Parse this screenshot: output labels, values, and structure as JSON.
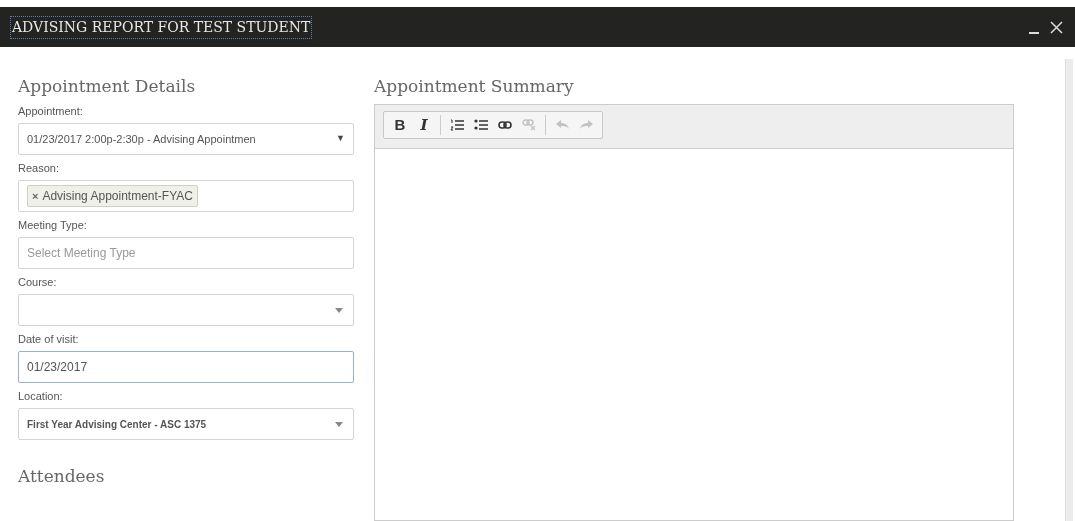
{
  "window": {
    "title": "ADVISING REPORT FOR TEST STUDENT"
  },
  "details": {
    "heading": "Appointment Details",
    "fields": [
      {
        "kind": "select",
        "label": "Appointment:",
        "value": "01/23/2017 2:00p-2:30p - Advising Appointmen",
        "caret": "▼"
      },
      {
        "kind": "tags",
        "label": "Reason:",
        "tags": [
          {
            "remove": "×",
            "text": "Advising Appointment-FYAC"
          }
        ]
      },
      {
        "kind": "text",
        "label": "Meeting Type:",
        "placeholder": "Select Meeting Type"
      },
      {
        "kind": "select",
        "label": "Course:"
      },
      {
        "kind": "text",
        "label": "Date of visit:",
        "value": "01/23/2017",
        "focused": true
      },
      {
        "kind": "select",
        "label": "Location:",
        "value": "First Year Advising Center - ASC 1375",
        "bold": true
      }
    ]
  },
  "attendees": {
    "heading": "Attendees"
  },
  "summary": {
    "heading": "Appointment Summary",
    "toolbar": [
      {
        "kind": "bold",
        "label": "B",
        "disabled": false
      },
      {
        "kind": "italic",
        "label": "I",
        "disabled": false
      },
      {
        "kind": "separator"
      },
      {
        "kind": "ordered-list",
        "disabled": false
      },
      {
        "kind": "bullet-list",
        "disabled": false
      },
      {
        "kind": "link",
        "disabled": false
      },
      {
        "kind": "unlink",
        "disabled": true
      },
      {
        "kind": "separator"
      },
      {
        "kind": "undo",
        "disabled": true
      },
      {
        "kind": "redo",
        "disabled": true
      }
    ]
  }
}
